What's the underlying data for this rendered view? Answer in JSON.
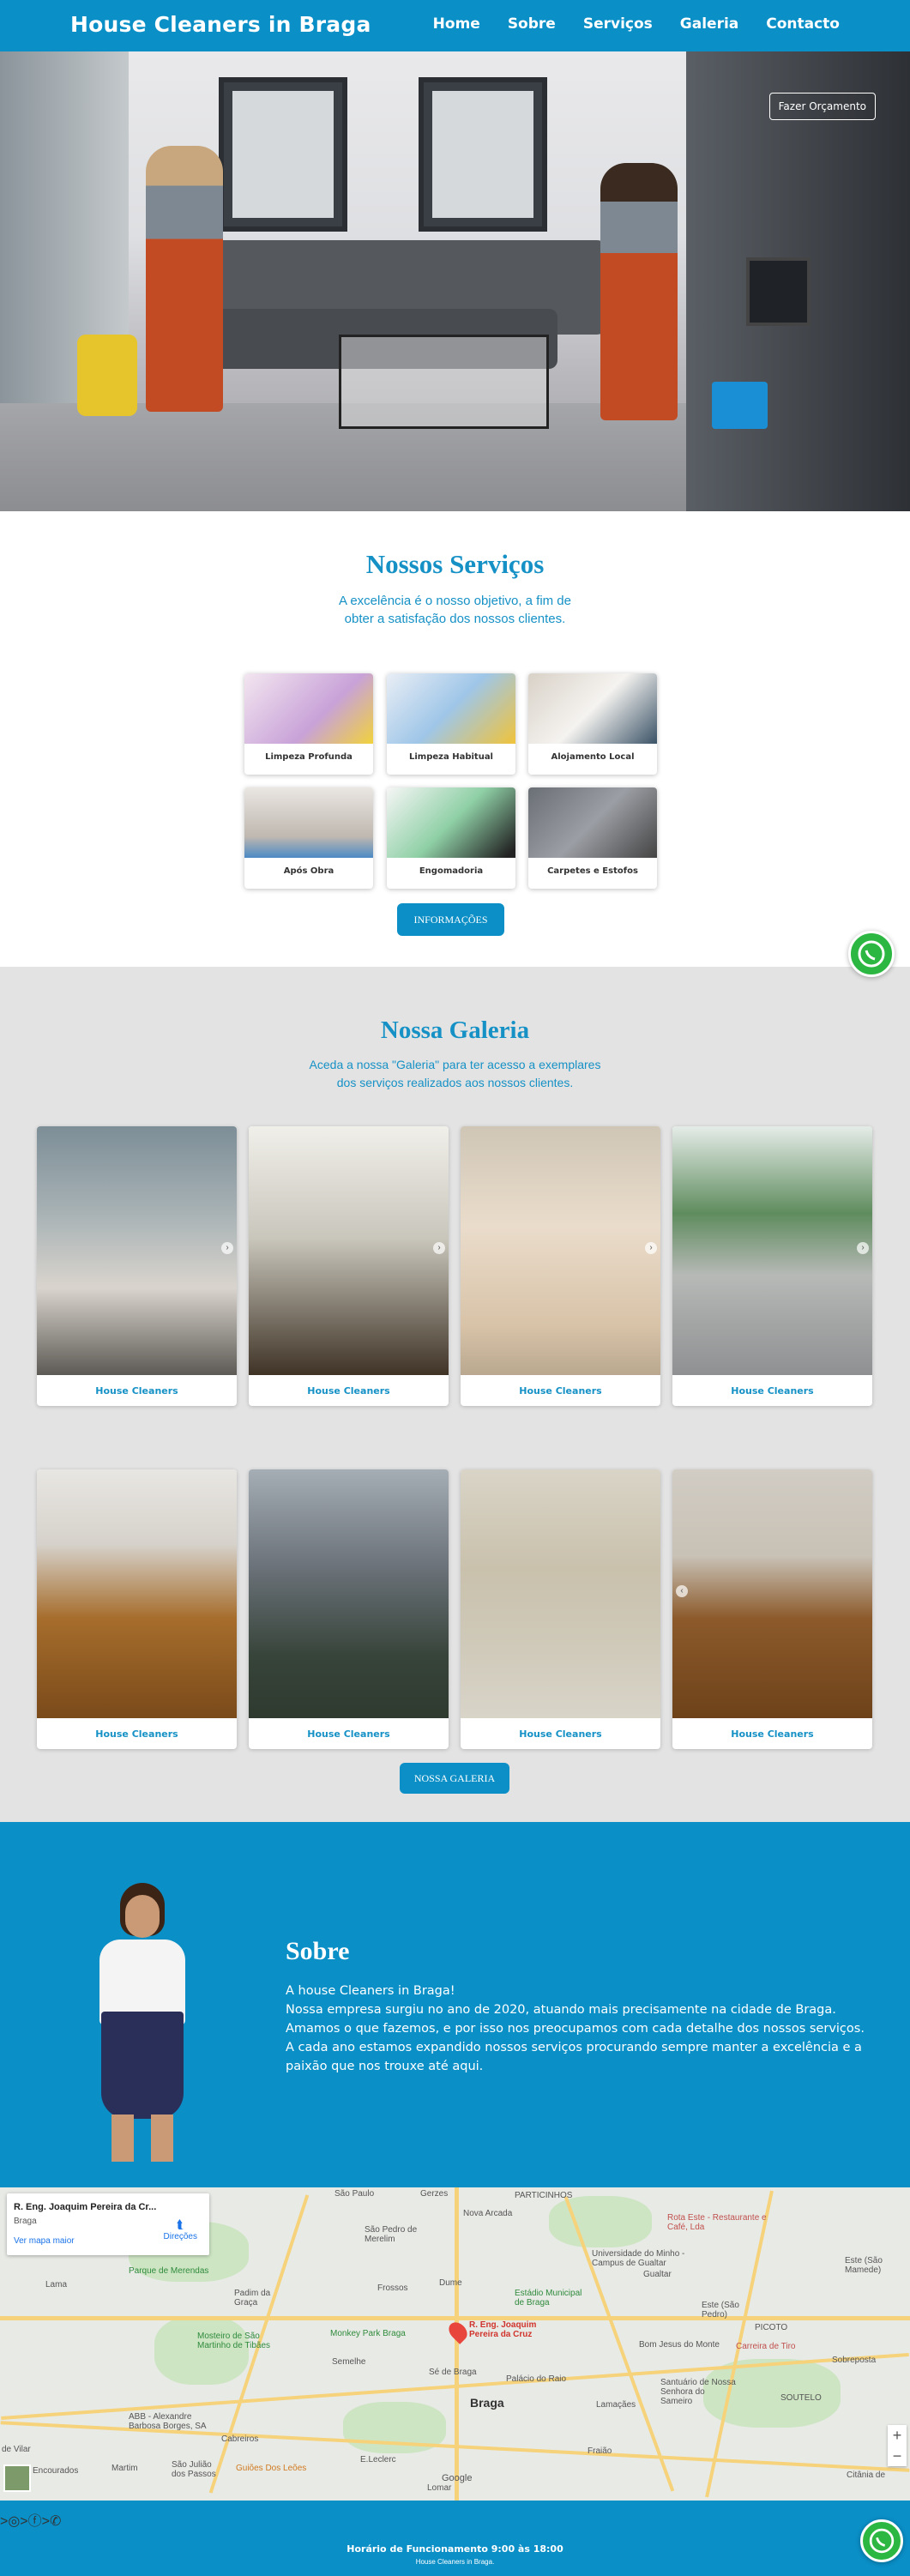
{
  "header": {
    "brand": "House Cleaners in Braga",
    "nav": [
      "Home",
      "Sobre",
      "Serviços",
      "Galeria",
      "Contacto"
    ]
  },
  "hero": {
    "quote_button": "Fazer Orçamento"
  },
  "services": {
    "title": "Nossos Serviços",
    "subtitle_line1": "A excelência é o nosso objetivo, a fim de",
    "subtitle_line2": "obter a satisfação dos nossos clientes.",
    "items": [
      "Limpeza Profunda",
      "Limpeza Habitual",
      "Alojamento Local",
      "Após Obra",
      "Engomadoria",
      "Carpetes e Estofos"
    ],
    "button": "INFORMAÇÕES"
  },
  "gallery": {
    "title": "Nossa Galeria",
    "subtitle_line1": "Aceda a nossa \"Galeria\" para ter acesso a exemplares",
    "subtitle_line2": "dos serviços realizados aos nossos clientes.",
    "card_label": "House Cleaners",
    "button": "NOSSA GALERIA"
  },
  "about": {
    "title": "Sobre",
    "line1": "A house Cleaners in Braga!",
    "line2": "Nossa empresa surgiu no ano de 2020, atuando mais precisamente na cidade de Braga.",
    "line3": "Amamos o que fazemos, e por isso nos preocupamos com cada detalhe dos nossos serviços.",
    "line4": "A cada ano estamos expandido nossos serviços procurando sempre manter a excelência e a",
    "line5": "paixão que nos trouxe até aqui."
  },
  "map": {
    "place_title": "R. Eng. Joaquim Pereira da Cr...",
    "place_city": "Braga",
    "larger_map": "Ver mapa maior",
    "directions": "Direções",
    "pin_label": "R. Eng. Joaquim Pereira da Cruz",
    "labels": [
      "São Paulo",
      "Gerzes",
      "PARTICINHOS",
      "São Pedro de Merelim",
      "Nova Arcada",
      "Rota Este - Restaurante e Café, Lda",
      "Universidade do Minho - Campus de Gualtar",
      "Gualtar",
      "Lama",
      "Parque de Merendas",
      "Padim da Graça",
      "Frossos",
      "Dume",
      "Estádio Municipal de Braga",
      "Este (São Pedro)",
      "Este (São Mamede)",
      "Mosteiro de São Martinho de Tibães",
      "Monkey Park Braga",
      "Bom Jesus do Monte",
      "PICOTO",
      "Carreira de Tiro",
      "Sobreposta",
      "Semelhe",
      "Sé de Braga",
      "Palácio do Raio",
      "Braga",
      "Santuário de Nossa Senhora do Sameiro",
      "SOUTELO",
      "ABB - Alexandre Barbosa Borges, SA",
      "Cabreiros",
      "Lamaçães",
      "Encourados",
      "Martim",
      "São Julião dos Passos",
      "Guiões Dos Leões",
      "E.Leclerc",
      "Fraião",
      "Lomar",
      "Citânia de",
      "de Vilar",
      "Google"
    ]
  },
  "footer": {
    "icons": ">◎>ⓕ>✆",
    "hours": "Horário de Funcionamento 9:00 às 18:00",
    "small": "House Cleaners in Braga."
  },
  "colors": {
    "primary": "#0a8fc7",
    "title_blue": "#1591c6",
    "whatsapp": "#2bb741"
  }
}
